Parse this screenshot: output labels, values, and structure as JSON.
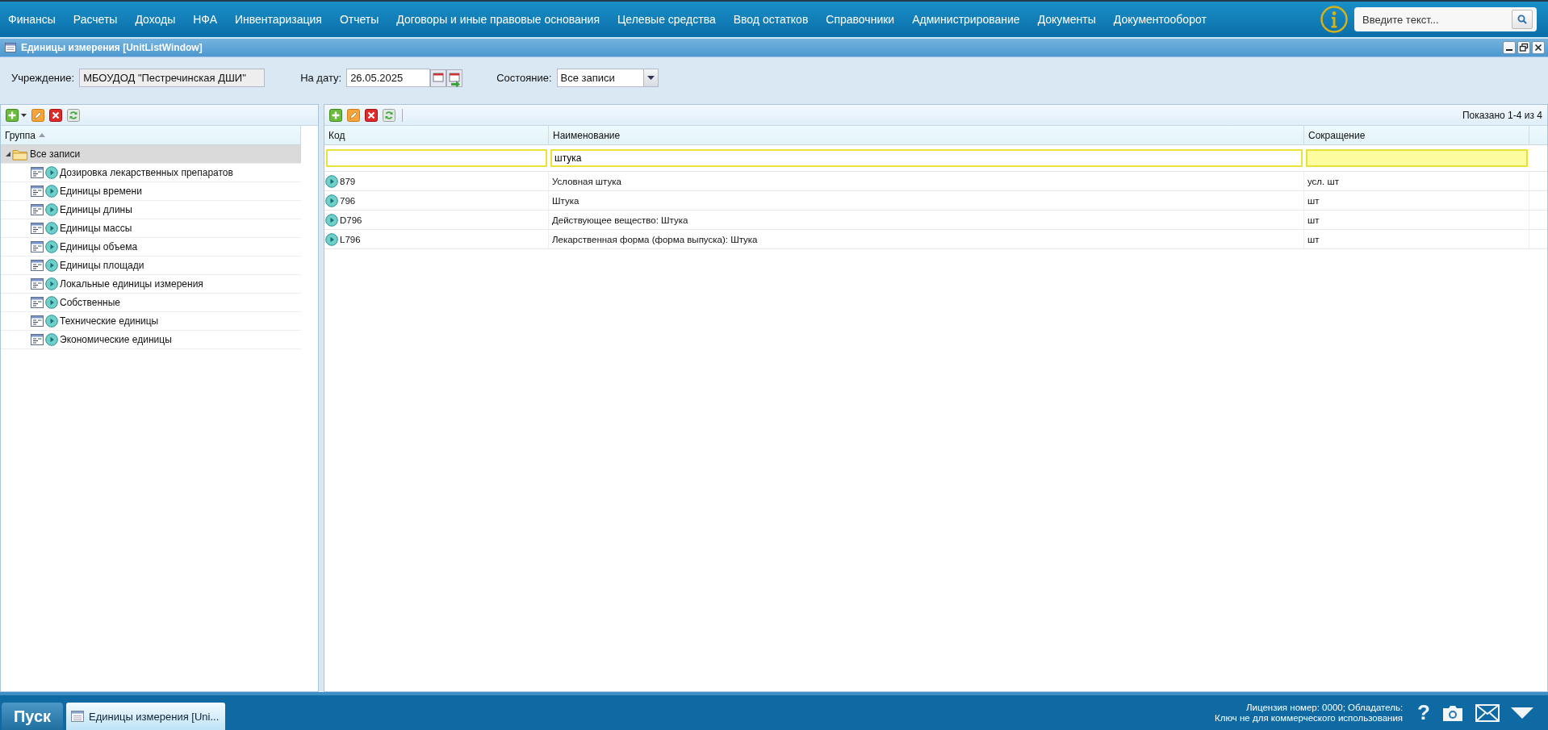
{
  "menu": [
    "Финансы",
    "Расчеты",
    "Доходы",
    "НФА",
    "Инвентаризация",
    "Отчеты",
    "Договоры и иные правовые основания",
    "Целевые средства",
    "Ввод остатков",
    "Справочники",
    "Администрирование",
    "Документы",
    "Документооборот"
  ],
  "search": {
    "placeholder": "Введите текст..."
  },
  "window": {
    "title": "Единицы измерения [UnitListWindow]"
  },
  "filters": {
    "institution": {
      "label": "Учреждение:",
      "value": "МБОУДОД \"Пестречинская ДШИ\""
    },
    "date": {
      "label": "На дату:",
      "value": "26.05.2025"
    },
    "state": {
      "label": "Состояние:",
      "value": "Все записи"
    }
  },
  "tree": {
    "column": "Группа",
    "root": {
      "label": "Все записи",
      "expanded": true,
      "selected": true,
      "children": [
        {
          "label": "Дозировка лекарственных препаратов",
          "selected": false
        },
        {
          "label": "Единицы времени",
          "selected": false
        },
        {
          "label": "Единицы длины",
          "selected": false
        },
        {
          "label": "Единицы массы",
          "selected": false
        },
        {
          "label": "Единицы объема",
          "selected": false
        },
        {
          "label": "Единицы площади",
          "selected": false
        },
        {
          "label": "Локальные единицы измерения",
          "selected": false
        },
        {
          "label": "Собственные",
          "selected": false
        },
        {
          "label": "Технические единицы",
          "selected": false
        },
        {
          "label": "Экономические единицы",
          "selected": false
        }
      ]
    }
  },
  "grid": {
    "summary": "Показано 1-4 из 4",
    "columns": [
      "Код",
      "Наименование",
      "Сокращение"
    ],
    "filters": [
      {
        "highlighted": false
      },
      {
        "value": "штука",
        "highlighted": false
      },
      {
        "highlighted": true
      }
    ],
    "rows": [
      {
        "code": "879",
        "name": "Условная штука",
        "short": "усл. шт"
      },
      {
        "code": "796",
        "name": "Штука",
        "short": "шт"
      },
      {
        "code": "D796",
        "name": "Действующее вещество: Штука",
        "short": "шт"
      },
      {
        "code": "L796",
        "name": "Лекарственная форма (форма выпуска): Штука",
        "short": "шт"
      }
    ]
  },
  "taskbar": {
    "start": "Пуск",
    "tasks": [
      {
        "label": "Единицы измерения [Uni...",
        "selected": true
      }
    ],
    "license": [
      "Лицензия номер: 0000; Обладатель:",
      "Ключ не для коммерческого использования"
    ],
    "help": "?"
  }
}
